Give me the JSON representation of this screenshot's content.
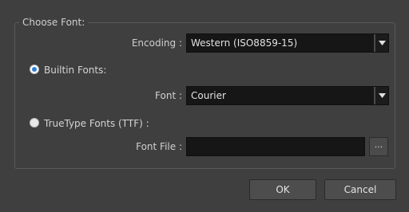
{
  "font_group": {
    "title": "Choose Font:",
    "encoding_label": "Encoding :",
    "encoding_value": "Western (ISO8859-15)",
    "builtin_radio_label": "Builtin Fonts:",
    "builtin_selected": true,
    "font_label": "Font :",
    "font_value": "Courier",
    "truetype_radio_label": "TrueType Fonts (TTF) :",
    "truetype_selected": false,
    "font_file_label": "Font File :",
    "font_file_value": "",
    "browse_label": "..."
  },
  "buttons": {
    "ok_label": "OK",
    "cancel_label": "Cancel"
  },
  "icons": {
    "combo_arrow": "chevron-down-icon",
    "radio_checked_color": "#2f7fd3"
  }
}
